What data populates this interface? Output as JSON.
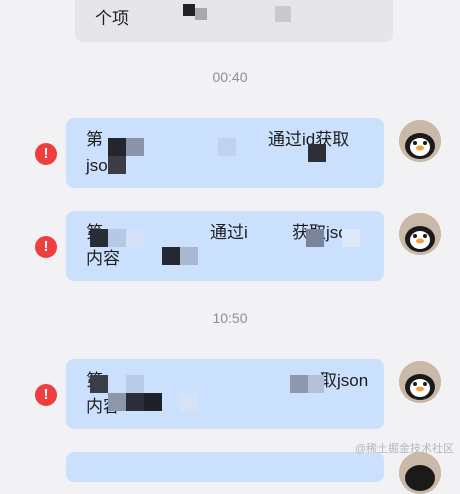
{
  "colors": {
    "background": "#f2f2f4",
    "incoming_bubble": "#e5e5ea",
    "outgoing_bubble": "#cbe0fd",
    "error": "#ef3e3e",
    "timestamp": "#8e8e93"
  },
  "messages": [
    {
      "direction": "incoming",
      "lines": [
        "个项",
        "…称"
      ]
    },
    {
      "timestamp": "00:40"
    },
    {
      "direction": "outgoing",
      "status": "failed",
      "status_icon": "error-icon",
      "lines": [
        "第",
        "…通过id获取",
        "jso"
      ]
    },
    {
      "direction": "outgoing",
      "status": "failed",
      "status_icon": "error-icon",
      "lines": [
        "第",
        "…通过id获取json",
        "内容"
      ]
    },
    {
      "timestamp": "10:50"
    },
    {
      "direction": "outgoing",
      "status": "failed",
      "status_icon": "error-icon",
      "lines": [
        "第",
        "取json",
        "内容"
      ]
    }
  ],
  "msg0": {
    "line1": "个项",
    "tail": "称"
  },
  "t1": "00:40",
  "msg1": {
    "a": "第",
    "b": "通过id获取",
    "c": "jso"
  },
  "msg2": {
    "a": "第",
    "b": "通过i",
    "c": "获取json",
    "d": "内容"
  },
  "t2": "10:50",
  "msg3": {
    "a": "第",
    "b": "取json",
    "c": "内容"
  },
  "error_glyph": "!",
  "watermark": "@稀土掘金技术社区"
}
